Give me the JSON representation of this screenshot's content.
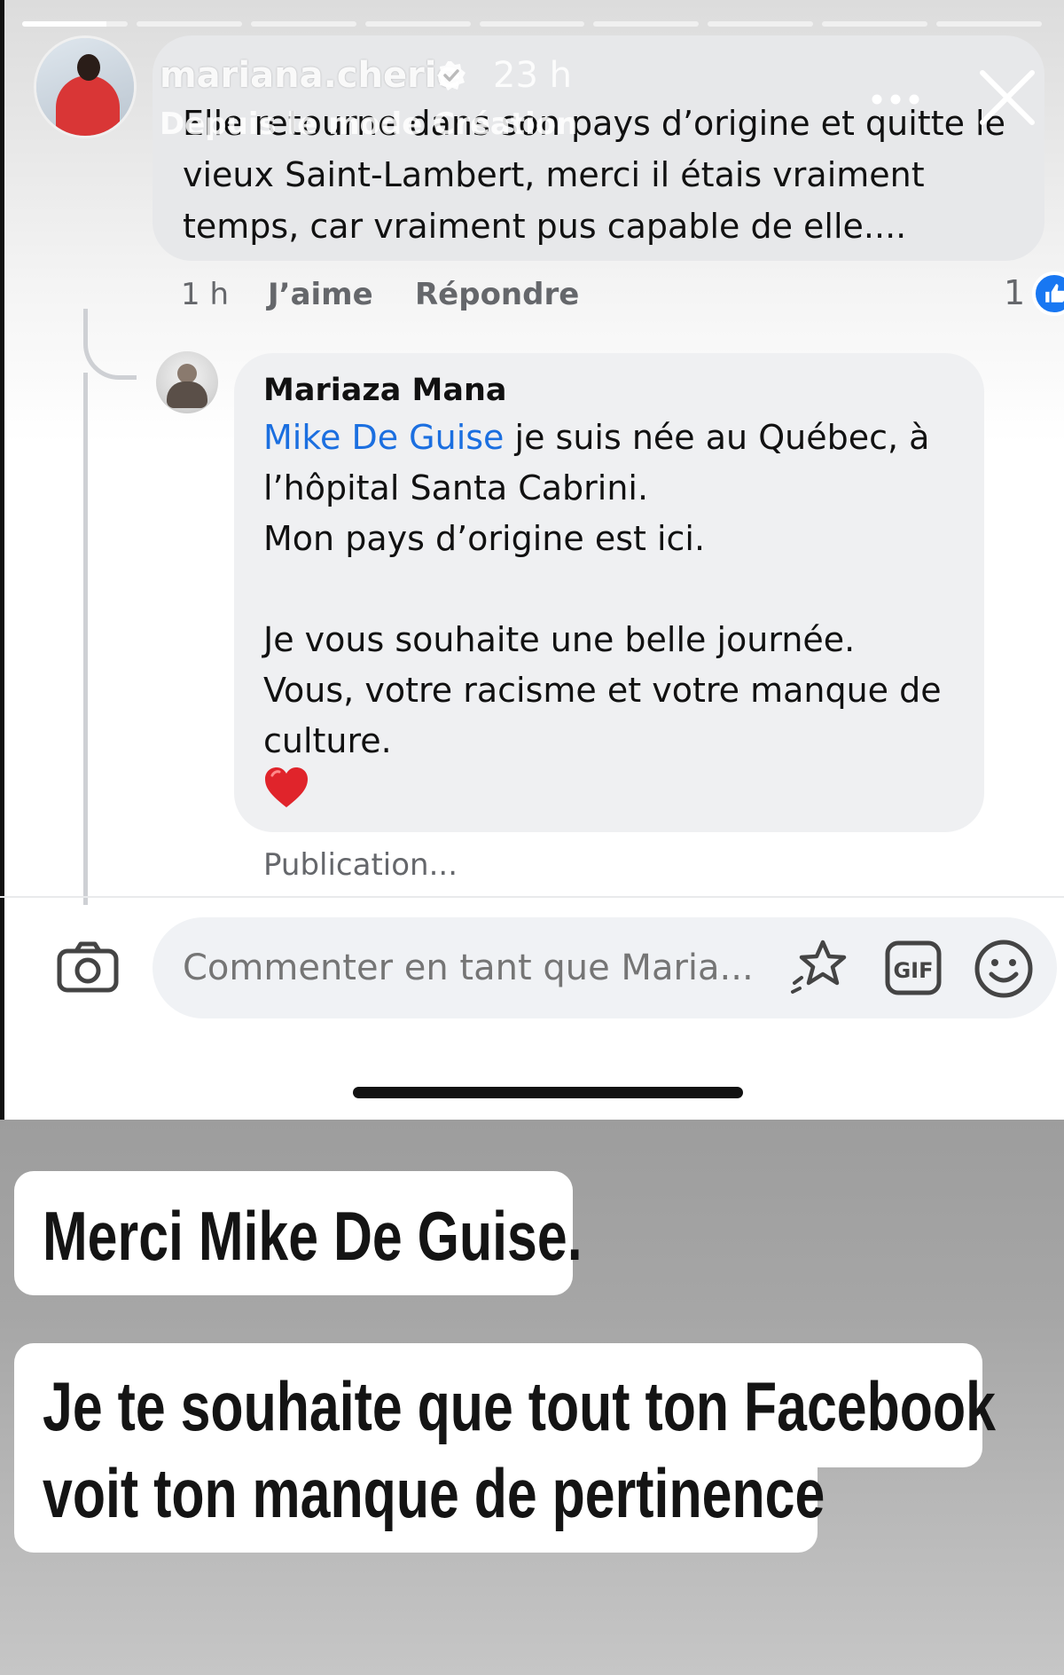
{
  "story": {
    "username": "mariana.cherie",
    "time": "23 h",
    "source": "Depuis le mode Création",
    "progress_segments": 9,
    "active_segment_fill": 0.8
  },
  "facebook": {
    "comment1": {
      "text": "Elle retourne dans son pays d’origine et quitte le vieux Saint-Lambert, merci il étais vraiment temps, car vraiment pus capable de elle....",
      "time": "1 h",
      "like_label": "J’aime",
      "reply_label": "Répondre",
      "reaction_count": "1"
    },
    "comment2": {
      "author": "Mariaza Mana",
      "mention": "Mike De Guise",
      "text_after_mention": " je suis née au Québec, à l’hôpital Santa Cabrini.\nMon pays d’origine est ici.\n\nJe vous souhaite une belle journée.\nVous, votre racisme et votre manque de culture.",
      "status": "Publication..."
    },
    "composer": {
      "placeholder": "Commenter en tant que Maria..."
    }
  },
  "stickers": {
    "line1": "Merci Mike De Guise.",
    "line2a": "Je te souhaite que tout ton Facebook",
    "line2b": "voit ton manque de pertinence"
  },
  "icons": {
    "camera": "camera-icon",
    "avatar_sticker": "avatar-sticker-icon",
    "gif": "gif-icon",
    "emoji": "emoji-icon",
    "close": "close-icon",
    "more": "more-icon",
    "verified": "verified-icon",
    "like": "like-badge-icon",
    "heart": "heart-icon"
  },
  "colors": {
    "facebook_blue": "#1877f2",
    "mention_blue": "#1b6fe0",
    "heart_red": "#e0242b"
  }
}
